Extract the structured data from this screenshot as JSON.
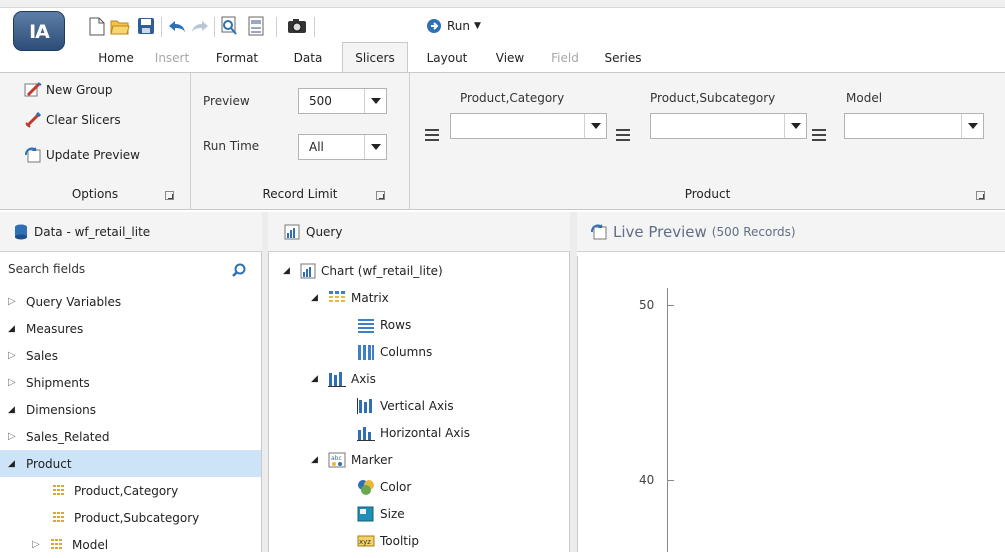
{
  "app": {
    "logo_text": "IA"
  },
  "toolbar": {
    "run_label": "Run"
  },
  "tabs": [
    {
      "label": "Home",
      "state": "normal"
    },
    {
      "label": "Insert",
      "state": "disabled"
    },
    {
      "label": "Format",
      "state": "normal"
    },
    {
      "label": "Data",
      "state": "normal"
    },
    {
      "label": "Slicers",
      "state": "active"
    },
    {
      "label": "Layout",
      "state": "normal"
    },
    {
      "label": "View",
      "state": "normal"
    },
    {
      "label": "Field",
      "state": "disabled"
    },
    {
      "label": "Series",
      "state": "normal"
    }
  ],
  "ribbon": {
    "options": {
      "new_group": "New Group",
      "clear_slicers": "Clear Slicers",
      "update_preview": "Update Preview",
      "group_label": "Options"
    },
    "record_limit": {
      "preview_label": "Preview",
      "preview_value": "500",
      "runtime_label": "Run Time",
      "runtime_value": "All",
      "group_label": "Record Limit"
    },
    "product": {
      "slicer1_label": "Product,Category",
      "slicer1_value": "",
      "slicer2_label": "Product,Subcategory",
      "slicer2_value": "",
      "slicer3_label": "Model",
      "slicer3_value": "",
      "group_label": "Product"
    }
  },
  "data_panel": {
    "title": "Data - wf_retail_lite",
    "search_placeholder": "Search fields",
    "items": [
      {
        "label": "Query Variables",
        "indent": 0,
        "state": "collapsed"
      },
      {
        "label": "Measures",
        "indent": 0,
        "state": "expanded"
      },
      {
        "label": "Sales",
        "indent": 0,
        "state": "collapsed"
      },
      {
        "label": "Shipments",
        "indent": 0,
        "state": "collapsed"
      },
      {
        "label": "Dimensions",
        "indent": 0,
        "state": "expanded"
      },
      {
        "label": "Sales_Related",
        "indent": 0,
        "state": "collapsed"
      },
      {
        "label": "Product",
        "indent": 0,
        "state": "expanded"
      },
      {
        "label": "Product,Category",
        "indent": 1,
        "state": "leaf"
      },
      {
        "label": "Product,Subcategory",
        "indent": 1,
        "state": "leaf"
      },
      {
        "label": "Model",
        "indent": 1,
        "state": "collapsed"
      }
    ]
  },
  "query_panel": {
    "title": "Query",
    "items": [
      {
        "label": "Chart (wf_retail_lite)",
        "icon": "chart-icon"
      },
      {
        "label": "Matrix",
        "icon": "matrix-icon"
      },
      {
        "label": "Rows",
        "icon": "rows-icon"
      },
      {
        "label": "Columns",
        "icon": "columns-icon"
      },
      {
        "label": "Axis",
        "icon": "axis-icon"
      },
      {
        "label": "Vertical Axis",
        "icon": "vertical-axis-icon"
      },
      {
        "label": "Horizontal Axis",
        "icon": "horizontal-axis-icon"
      },
      {
        "label": "Marker",
        "icon": "marker-icon"
      },
      {
        "label": "Color",
        "icon": "color-icon"
      },
      {
        "label": "Size",
        "icon": "size-icon"
      },
      {
        "label": "Tooltip",
        "icon": "tooltip-icon"
      }
    ]
  },
  "preview": {
    "title": "Live Preview",
    "records": "(500 Records)",
    "y_ticks": [
      "50",
      "40"
    ]
  },
  "colors": {
    "selected_row": "#cde3f7",
    "ribbon_bg": "#f4f4f4",
    "accent_blue": "#2f6fb5",
    "preview_title": "#5f6f85"
  }
}
